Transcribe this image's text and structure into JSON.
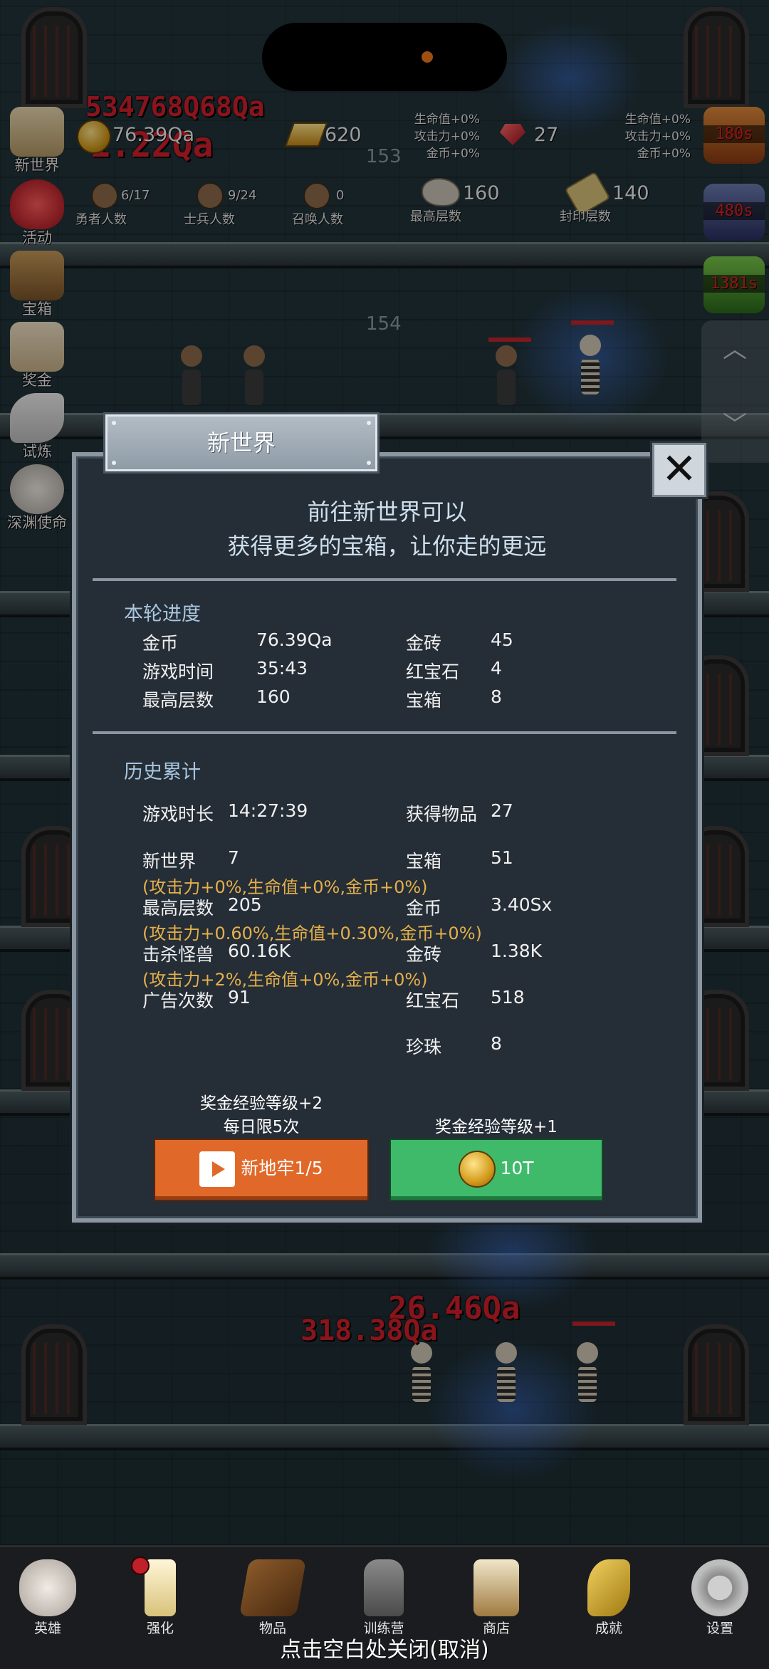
{
  "hud": {
    "gold": "76.39Qa",
    "gold_bars": "620",
    "rubies": "27",
    "gold_bar_bonus": [
      "生命值+0%",
      "攻击力+0%",
      "金币+0%"
    ],
    "ruby_bonus": [
      "生命值+0%",
      "攻击力+0%",
      "金币+0%"
    ],
    "overlay_damage_1": "534768Q68Qa",
    "overlay_damage_2": "1.22Qa",
    "heroes": {
      "value": "6/17",
      "label": "勇者人数"
    },
    "soldiers": {
      "value": "9/24",
      "label": "士兵人数"
    },
    "summons": {
      "value": "0",
      "label": "召唤人数"
    },
    "max_floor": {
      "value": "160",
      "label": "最高层数"
    },
    "seal_floor": {
      "value": "140",
      "label": "封印层数"
    }
  },
  "left_menu": [
    "新世界",
    "活动",
    "宝箱",
    "奖金",
    "试炼",
    "深渊使命"
  ],
  "right_timers": [
    "180s",
    "480s",
    "1381s"
  ],
  "floor_numbers": [
    "153",
    "154"
  ],
  "battle_damage": [
    "26.46Qa",
    "318.38Qa"
  ],
  "modal": {
    "title": "新世界",
    "headline_1": "前往新世界可以",
    "headline_2": "获得更多的宝箱，让你走的更远",
    "round_section": "本轮进度",
    "round": {
      "gold_label": "金币",
      "gold_value": "76.39Qa",
      "time_label": "游戏时间",
      "time_value": "35:43",
      "maxfloor_label": "最高层数",
      "maxfloor_value": "160",
      "goldbar_label": "金砖",
      "goldbar_value": "45",
      "ruby_label": "红宝石",
      "ruby_value": "4",
      "chest_label": "宝箱",
      "chest_value": "8"
    },
    "history_section": "历史累计",
    "history": {
      "duration_label": "游戏时长",
      "duration_value": "14:27:39",
      "items_label": "获得物品",
      "items_value": "27",
      "newworld_label": "新世界",
      "newworld_value": "7",
      "newworld_note": "(攻击力+0%,生命值+0%,金币+0%)",
      "chest_label": "宝箱",
      "chest_value": "51",
      "maxfloor_label": "最高层数",
      "maxfloor_value": "205",
      "maxfloor_note": "(攻击力+0.60%,生命值+0.30%,金币+0%)",
      "gold_label": "金币",
      "gold_value": "3.40Sx",
      "kills_label": "击杀怪兽",
      "kills_value": "60.16K",
      "kills_note": "(攻击力+2%,生命值+0%,金币+0%)",
      "goldbar_label": "金砖",
      "goldbar_value": "1.38K",
      "ads_label": "广告次数",
      "ads_value": "91",
      "ruby_label": "红宝石",
      "ruby_value": "518",
      "pearl_label": "珍珠",
      "pearl_value": "8"
    },
    "left_hint_1": "奖金经验等级+2",
    "left_hint_2": "每日限5次",
    "right_hint": "奖金经验等级+1",
    "ad_button": "新地牢1/5",
    "gold_button": "10T"
  },
  "bottom_nav": [
    "英雄",
    "强化",
    "物品",
    "训练营",
    "商店",
    "成就",
    "设置"
  ],
  "close_hint": "点击空白处关闭(取消)",
  "colors": {
    "accent_orange": "#e0692a",
    "accent_green": "#3fba6b",
    "note_gold": "#e3b04b",
    "damage_red": "#d4202c"
  }
}
